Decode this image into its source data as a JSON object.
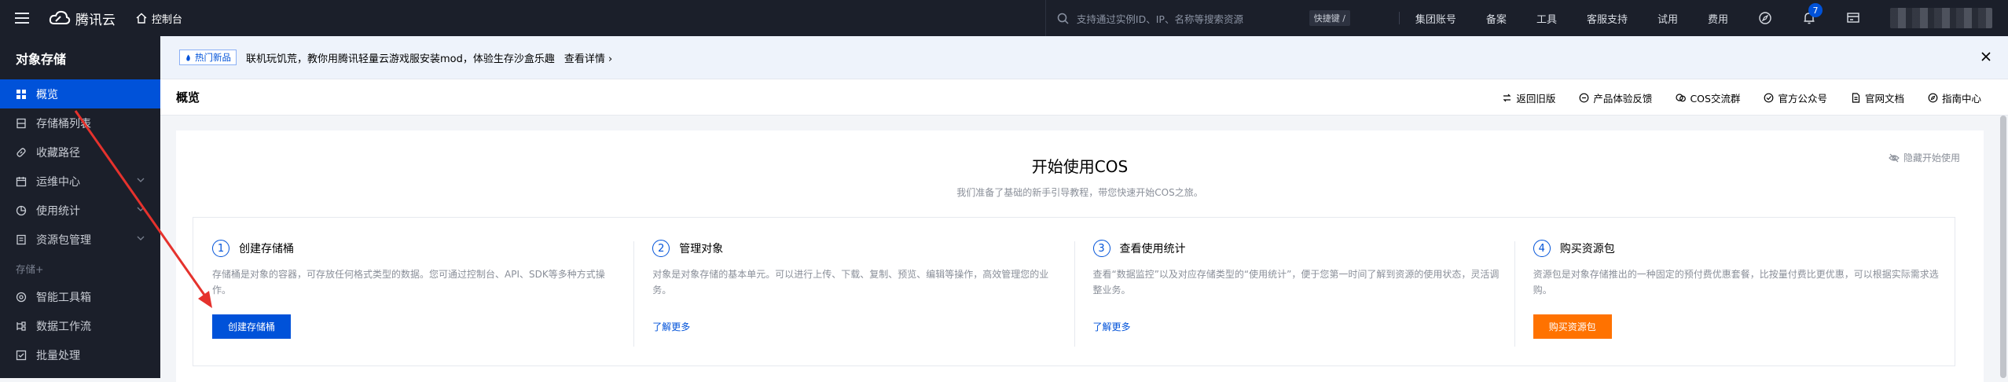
{
  "topnav": {
    "brand": "腾讯云",
    "console": "控制台",
    "search_placeholder": "支持通过实例ID、IP、名称等搜索资源",
    "shortcut": "快捷键 /",
    "links": [
      "集团账号",
      "备案",
      "工具",
      "客服支持",
      "试用",
      "费用"
    ],
    "notification_count": "7"
  },
  "sidebar": {
    "title": "对象存储",
    "items": [
      {
        "label": "概览",
        "active": true
      },
      {
        "label": "存储桶列表"
      },
      {
        "label": "收藏路径"
      },
      {
        "label": "运维中心",
        "has_children": true
      },
      {
        "label": "使用统计",
        "has_children": true
      },
      {
        "label": "资源包管理",
        "has_children": true
      }
    ],
    "group": "存储+",
    "items2": [
      {
        "label": "智能工具箱"
      },
      {
        "label": "数据工作流"
      },
      {
        "label": "批量处理"
      }
    ]
  },
  "announce": {
    "tag": "热门新品",
    "text": "联机玩饥荒，教你用腾讯轻量云游戏服安装mod，体验生存沙盒乐趣",
    "detail": "查看详情 ›"
  },
  "page": {
    "title": "概览",
    "header_links": [
      "返回旧版",
      "产品体验反馈",
      "COS交流群",
      "官方公众号",
      "官网文档",
      "指南中心"
    ]
  },
  "guide": {
    "title": "开始使用COS",
    "subtitle": "我们准备了基础的新手引导教程，带您快速开始COS之旅。",
    "hide": "隐藏开始使用",
    "steps": [
      {
        "num": "1",
        "title": "创建存储桶",
        "desc": "存储桶是对象的容器，可存放任何格式类型的数据。您可通过控制台、API、SDK等多种方式操作。",
        "button": "创建存储桶"
      },
      {
        "num": "2",
        "title": "管理对象",
        "desc": "对象是对象存储的基本单元。可以进行上传、下载、复制、预览、编辑等操作，高效管理您的业务。",
        "link": "了解更多"
      },
      {
        "num": "3",
        "title": "查看使用统计",
        "desc": "查看“数据监控”以及对应存储类型的“使用统计”，便于您第一时间了解到资源的使用状态，灵活调整业务。",
        "link": "了解更多"
      },
      {
        "num": "4",
        "title": "购买资源包",
        "desc": "资源包是对象存储推出的一种固定的预付费优惠套餐，比按量付费比更优惠，可以根据实际需求选购。",
        "button": "购买资源包"
      }
    ]
  },
  "colors": {
    "brand_blue": "#0052d9",
    "orange": "#ff7200",
    "nav_bg": "#1b1f2a"
  }
}
